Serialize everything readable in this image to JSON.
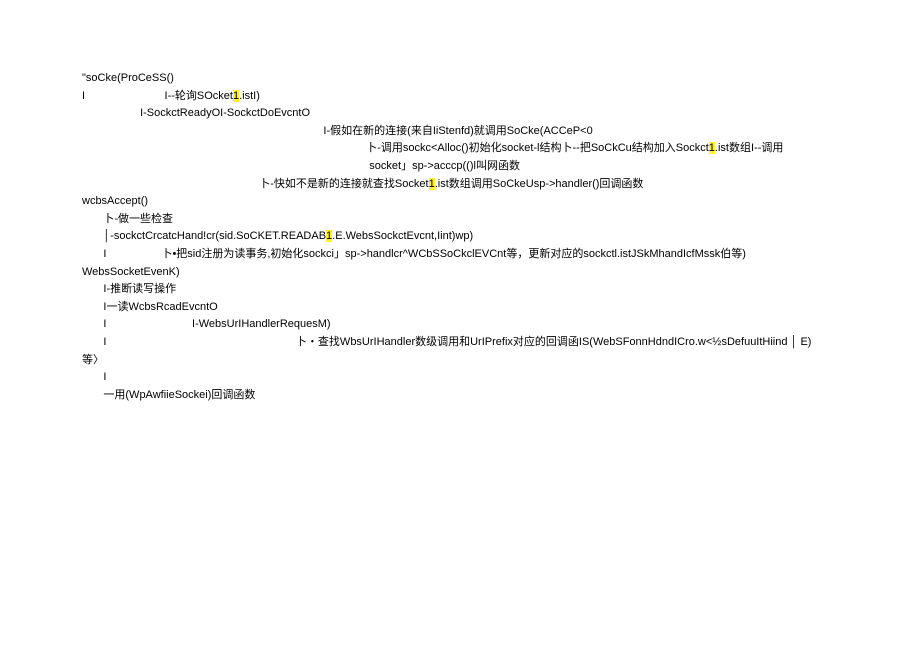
{
  "lines": {
    "l1": "\"soCke(ProCeSS()",
    "l2a": "I                          I--轮询SOcket",
    "l2b": ".istI)",
    "l3": "                   I-SockctReadyOI-SockctDoEvcntO",
    "l4": "                                                                               I-假如在新的连接(来自IiStenfd)就调用SoCke(ACCeP<0",
    "l5a": "                                                                                             卜-调用sockc<Alloc()初始化socket-l结构卜--把SoCkCu结构加入Sockct",
    "l5b": ".ist数组I--调用",
    "l6": "                                                                                              socket」sp->acccp(()l叫网函数",
    "l7": "",
    "l8a": "                                                          卜-快如不是新的连接就查找Socket",
    "l8b": ".ist数组调用SoCkeUsp->handler()回调函数",
    "l9": "",
    "l10": "",
    "l11": "",
    "l12": "wcbsAccept()",
    "l13": "       卜-做一些检查",
    "l14a": "       │-sockctCrcatcHand!cr(sid.SoCKET.READAB",
    "l14b": ".E.WebsSockctEvcnt,Iint)wp)",
    "l15": "       I                  卜•把sid注册为读事务,初始化sockci」sp->handlcr^WCbSSoCkclEVCnt等，更新对应的sockctl.istJSkMhandIcfMssk伯等)",
    "l16": "",
    "l17": "WebsSocketEvenK)",
    "l18": "       I-推断读写操作",
    "l19": "       I一读WcbsRcadEvcntO",
    "l20": "       I                            I-WebsUrIHandlerRequesM)",
    "l21": "       I                                                              卜・查找WbsUrIHandler数级调用和UrIPrefix对应的回调函IS(WebSFonnHdndICro.w<½sDefuuItHiind │ E)",
    "l22": "等〉",
    "l23": "       I",
    "l24": "       一用(WpAwfiieSockei)回调函数"
  },
  "highlight": "1"
}
